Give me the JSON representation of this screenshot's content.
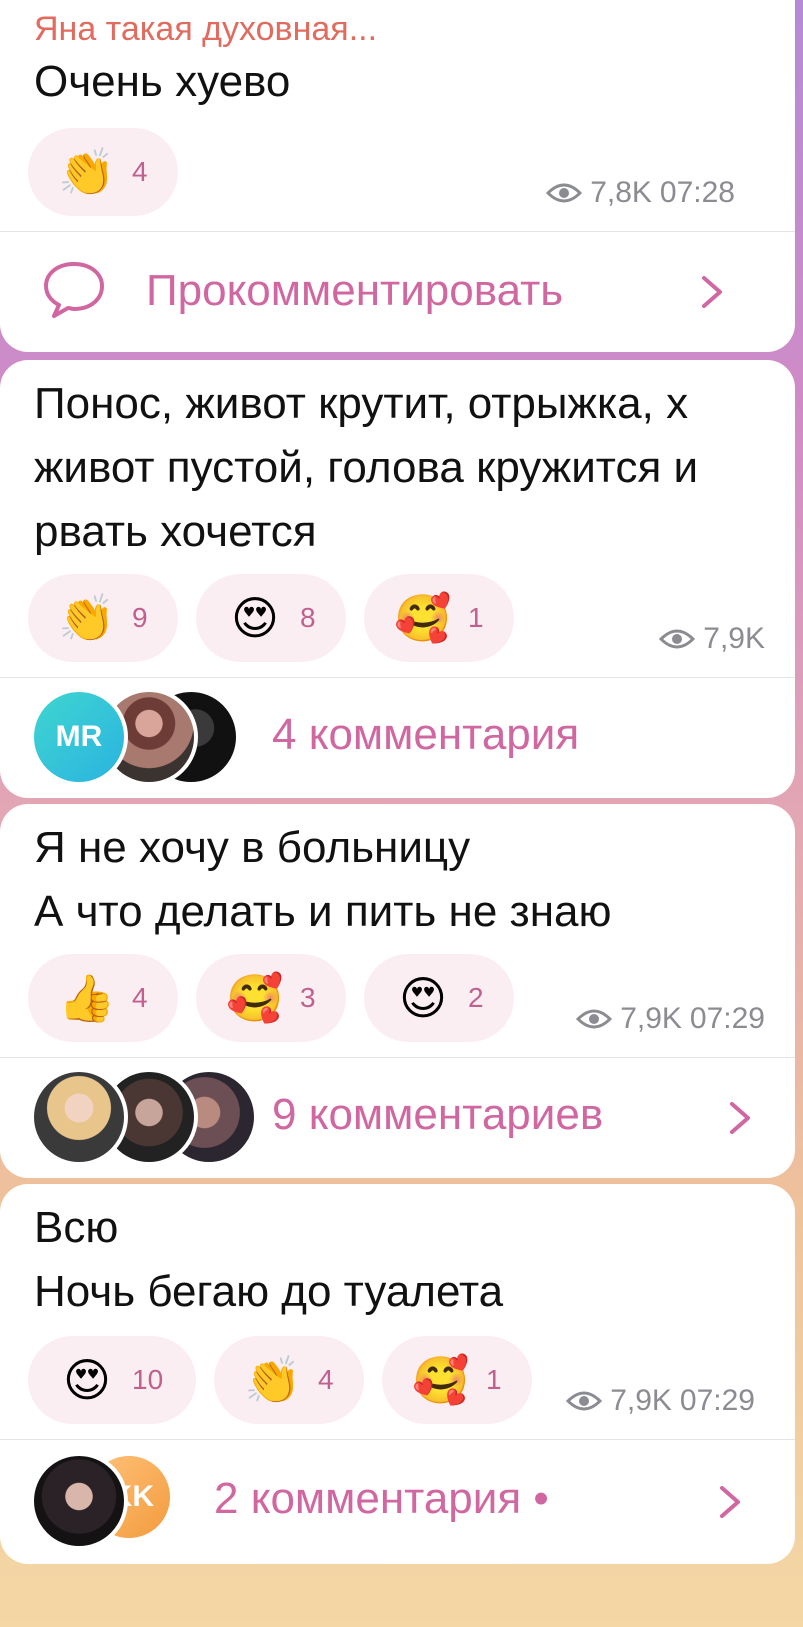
{
  "posts": [
    {
      "sender": "Яна такая духовная...",
      "lines": [
        "Очень хуево"
      ],
      "reactions": [
        {
          "emoji": "👏",
          "count": "4"
        }
      ],
      "views": "7,8K",
      "time": "07:28",
      "footer": "Прокомментировать"
    },
    {
      "lines": [
        "Понос, живот крутит, отрыжка, х",
        "живот пустой, голова кружится и",
        "рвать хочется"
      ],
      "reactions": [
        {
          "emoji": "👏",
          "count": "9"
        },
        {
          "emoji": "😍",
          "count": "8"
        },
        {
          "emoji": "🥰",
          "count": "1"
        }
      ],
      "views": "7,9K",
      "time": "",
      "avatars": [
        {
          "initials": "MR"
        }
      ],
      "footer": "4 комментария"
    },
    {
      "lines": [
        "Я не хочу в больницу",
        "А что делать и пить не знаю"
      ],
      "reactions": [
        {
          "emoji": "👍",
          "count": "4"
        },
        {
          "emoji": "🥰",
          "count": "3"
        },
        {
          "emoji": "😍",
          "count": "2"
        }
      ],
      "views": "7,9K",
      "time": "07:29",
      "footer": "9 комментариев"
    },
    {
      "lines": [
        "Всю",
        "Ночь бегаю до туалета"
      ],
      "reactions": [
        {
          "emoji": "😍",
          "count": "10"
        },
        {
          "emoji": "👏",
          "count": "4"
        },
        {
          "emoji": "🥰",
          "count": "1"
        }
      ],
      "views": "7,9K",
      "time": "07:29",
      "avatars": [
        {
          "initials": "KK"
        }
      ],
      "footer": "2 комментария •"
    }
  ],
  "colors": {
    "accent": "#d067a1",
    "sender": "#e06b5e",
    "pill_bg": "#fbeef3",
    "meta": "#8b8b92"
  }
}
